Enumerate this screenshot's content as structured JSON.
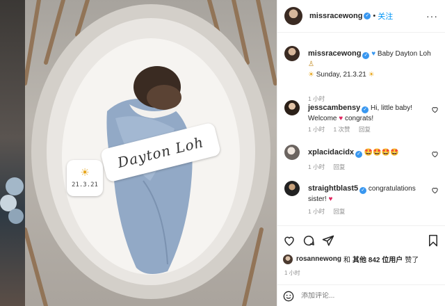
{
  "post": {
    "author": "missracewong",
    "follow_label": "关注",
    "overlay": {
      "date": "21.3.21",
      "name": "Dayton Loh"
    }
  },
  "caption": {
    "user": "missracewong",
    "text": "Baby Dayton Loh",
    "line2": "Sunday, 21.3.21",
    "time": "1 小时"
  },
  "comments": [
    {
      "user": "jesscambensy",
      "text_a": "Hi, little baby!",
      "text_b": "Welcome",
      "text_c": "congrats!",
      "time": "1 小时",
      "likes": "1 次赞",
      "reply": "回复"
    },
    {
      "user": "xplacidacidx",
      "text": "🤩🤩🤩🤩",
      "time": "1 小时",
      "reply": "回复"
    },
    {
      "user": "straightblast5",
      "text_a": "congratulations",
      "text_b": "sister!",
      "time": "1 小时",
      "reply": "回复"
    }
  ],
  "likes": {
    "user": "rosannewong",
    "and": "和",
    "others": "其他 842 位用户",
    "suffix": "赞了"
  },
  "post_time": "1 小时",
  "add_comment": {
    "placeholder": "添加评论..."
  },
  "colors": {
    "link": "#0095f6",
    "verified": "#3897f0",
    "heart": "#e0245e",
    "meta": "#8e8e8e"
  },
  "icons": [
    "heart-icon",
    "comment-icon",
    "share-icon",
    "bookmark-icon",
    "smile-icon",
    "verified-icon",
    "sun-emoji",
    "blue-heart-emoji"
  ]
}
